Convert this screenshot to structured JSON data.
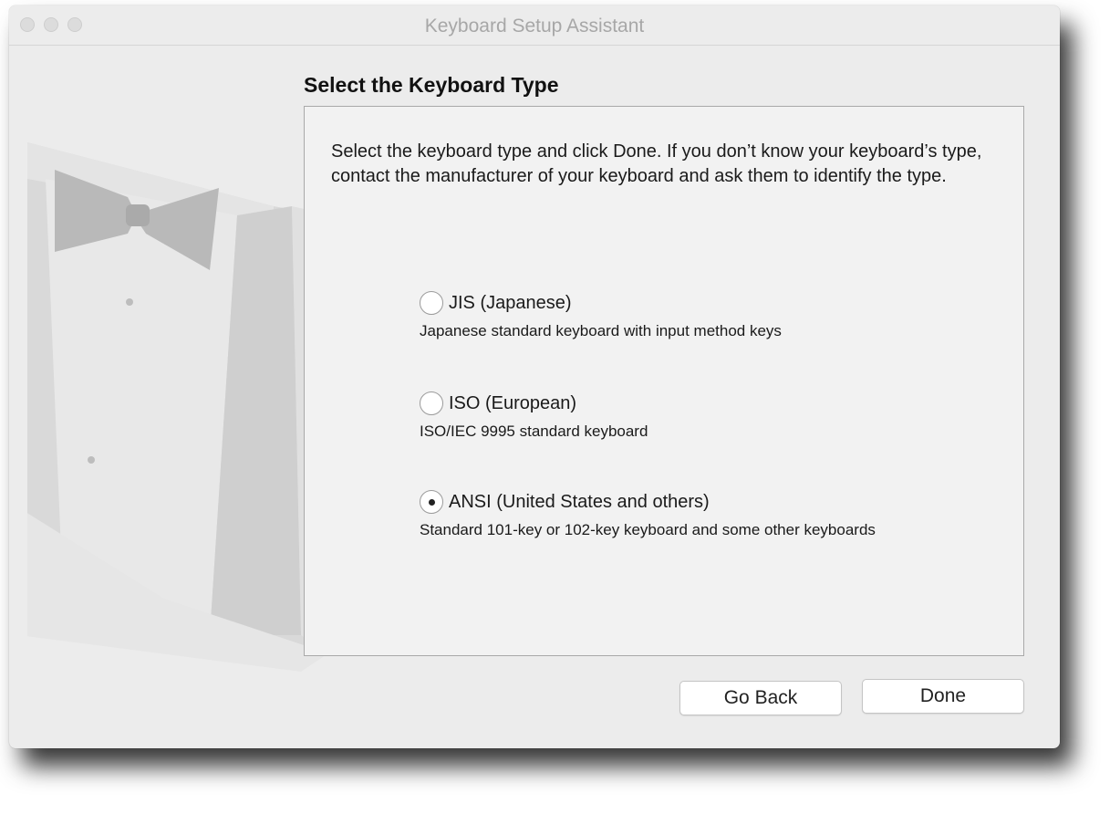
{
  "window": {
    "title": "Keyboard Setup Assistant"
  },
  "main": {
    "heading": "Select the Keyboard Type",
    "intro": "Select the keyboard type and click Done. If you don’t know your keyboard’s type, contact the manufacturer of your keyboard and ask them to identify the type.",
    "options": [
      {
        "label": "JIS (Japanese)",
        "description": "Japanese standard keyboard with input method keys",
        "selected": false
      },
      {
        "label": "ISO (European)",
        "description": "ISO/IEC 9995 standard keyboard",
        "selected": false
      },
      {
        "label": "ANSI (United States and others)",
        "description": "Standard 101-key or 102-key keyboard and some other keyboards",
        "selected": true
      }
    ]
  },
  "buttons": {
    "back_label": "Go Back",
    "done_label": "Done"
  },
  "icons": {
    "decoration": "tuxedo-bowtie-icon"
  },
  "colors": {
    "window_bg": "#ececec",
    "panel_bg": "#f2f2f2",
    "title_text": "#a7a7a7"
  }
}
